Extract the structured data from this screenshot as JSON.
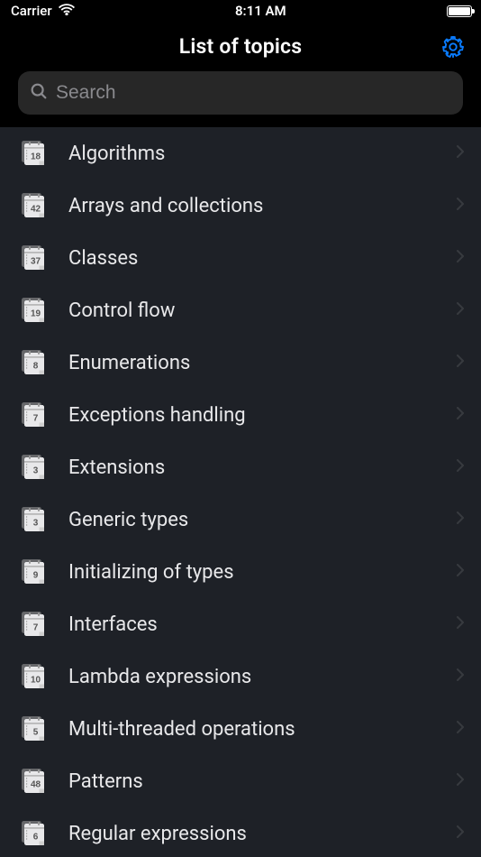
{
  "status": {
    "carrier": "Carrier",
    "time": "8:11 AM"
  },
  "header": {
    "title": "List of topics"
  },
  "search": {
    "placeholder": "Search"
  },
  "topics": [
    {
      "count": "18",
      "label": "Algorithms"
    },
    {
      "count": "42",
      "label": "Arrays and collections"
    },
    {
      "count": "37",
      "label": "Classes"
    },
    {
      "count": "19",
      "label": "Control flow"
    },
    {
      "count": "8",
      "label": "Enumerations"
    },
    {
      "count": "7",
      "label": "Exceptions handling"
    },
    {
      "count": "3",
      "label": "Extensions"
    },
    {
      "count": "3",
      "label": "Generic types"
    },
    {
      "count": "9",
      "label": "Initializing of types"
    },
    {
      "count": "7",
      "label": "Interfaces"
    },
    {
      "count": "10",
      "label": "Lambda expressions"
    },
    {
      "count": "5",
      "label": "Multi-threaded operations"
    },
    {
      "count": "48",
      "label": "Patterns"
    },
    {
      "count": "6",
      "label": "Regular expressions"
    }
  ]
}
